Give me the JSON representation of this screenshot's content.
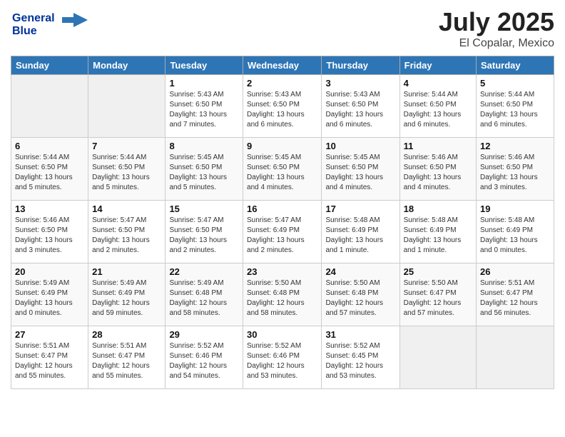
{
  "header": {
    "logo_line1": "General",
    "logo_line2": "Blue",
    "title": "July 2025",
    "subtitle": "El Copalar, Mexico"
  },
  "days_of_week": [
    "Sunday",
    "Monday",
    "Tuesday",
    "Wednesday",
    "Thursday",
    "Friday",
    "Saturday"
  ],
  "weeks": [
    [
      {
        "day": "",
        "empty": true
      },
      {
        "day": "",
        "empty": true
      },
      {
        "day": "1",
        "sunrise": "Sunrise: 5:43 AM",
        "sunset": "Sunset: 6:50 PM",
        "daylight": "Daylight: 13 hours and 7 minutes."
      },
      {
        "day": "2",
        "sunrise": "Sunrise: 5:43 AM",
        "sunset": "Sunset: 6:50 PM",
        "daylight": "Daylight: 13 hours and 6 minutes."
      },
      {
        "day": "3",
        "sunrise": "Sunrise: 5:43 AM",
        "sunset": "Sunset: 6:50 PM",
        "daylight": "Daylight: 13 hours and 6 minutes."
      },
      {
        "day": "4",
        "sunrise": "Sunrise: 5:44 AM",
        "sunset": "Sunset: 6:50 PM",
        "daylight": "Daylight: 13 hours and 6 minutes."
      },
      {
        "day": "5",
        "sunrise": "Sunrise: 5:44 AM",
        "sunset": "Sunset: 6:50 PM",
        "daylight": "Daylight: 13 hours and 6 minutes."
      }
    ],
    [
      {
        "day": "6",
        "sunrise": "Sunrise: 5:44 AM",
        "sunset": "Sunset: 6:50 PM",
        "daylight": "Daylight: 13 hours and 5 minutes."
      },
      {
        "day": "7",
        "sunrise": "Sunrise: 5:44 AM",
        "sunset": "Sunset: 6:50 PM",
        "daylight": "Daylight: 13 hours and 5 minutes."
      },
      {
        "day": "8",
        "sunrise": "Sunrise: 5:45 AM",
        "sunset": "Sunset: 6:50 PM",
        "daylight": "Daylight: 13 hours and 5 minutes."
      },
      {
        "day": "9",
        "sunrise": "Sunrise: 5:45 AM",
        "sunset": "Sunset: 6:50 PM",
        "daylight": "Daylight: 13 hours and 4 minutes."
      },
      {
        "day": "10",
        "sunrise": "Sunrise: 5:45 AM",
        "sunset": "Sunset: 6:50 PM",
        "daylight": "Daylight: 13 hours and 4 minutes."
      },
      {
        "day": "11",
        "sunrise": "Sunrise: 5:46 AM",
        "sunset": "Sunset: 6:50 PM",
        "daylight": "Daylight: 13 hours and 4 minutes."
      },
      {
        "day": "12",
        "sunrise": "Sunrise: 5:46 AM",
        "sunset": "Sunset: 6:50 PM",
        "daylight": "Daylight: 13 hours and 3 minutes."
      }
    ],
    [
      {
        "day": "13",
        "sunrise": "Sunrise: 5:46 AM",
        "sunset": "Sunset: 6:50 PM",
        "daylight": "Daylight: 13 hours and 3 minutes."
      },
      {
        "day": "14",
        "sunrise": "Sunrise: 5:47 AM",
        "sunset": "Sunset: 6:50 PM",
        "daylight": "Daylight: 13 hours and 2 minutes."
      },
      {
        "day": "15",
        "sunrise": "Sunrise: 5:47 AM",
        "sunset": "Sunset: 6:50 PM",
        "daylight": "Daylight: 13 hours and 2 minutes."
      },
      {
        "day": "16",
        "sunrise": "Sunrise: 5:47 AM",
        "sunset": "Sunset: 6:49 PM",
        "daylight": "Daylight: 13 hours and 2 minutes."
      },
      {
        "day": "17",
        "sunrise": "Sunrise: 5:48 AM",
        "sunset": "Sunset: 6:49 PM",
        "daylight": "Daylight: 13 hours and 1 minute."
      },
      {
        "day": "18",
        "sunrise": "Sunrise: 5:48 AM",
        "sunset": "Sunset: 6:49 PM",
        "daylight": "Daylight: 13 hours and 1 minute."
      },
      {
        "day": "19",
        "sunrise": "Sunrise: 5:48 AM",
        "sunset": "Sunset: 6:49 PM",
        "daylight": "Daylight: 13 hours and 0 minutes."
      }
    ],
    [
      {
        "day": "20",
        "sunrise": "Sunrise: 5:49 AM",
        "sunset": "Sunset: 6:49 PM",
        "daylight": "Daylight: 13 hours and 0 minutes."
      },
      {
        "day": "21",
        "sunrise": "Sunrise: 5:49 AM",
        "sunset": "Sunset: 6:49 PM",
        "daylight": "Daylight: 12 hours and 59 minutes."
      },
      {
        "day": "22",
        "sunrise": "Sunrise: 5:49 AM",
        "sunset": "Sunset: 6:48 PM",
        "daylight": "Daylight: 12 hours and 58 minutes."
      },
      {
        "day": "23",
        "sunrise": "Sunrise: 5:50 AM",
        "sunset": "Sunset: 6:48 PM",
        "daylight": "Daylight: 12 hours and 58 minutes."
      },
      {
        "day": "24",
        "sunrise": "Sunrise: 5:50 AM",
        "sunset": "Sunset: 6:48 PM",
        "daylight": "Daylight: 12 hours and 57 minutes."
      },
      {
        "day": "25",
        "sunrise": "Sunrise: 5:50 AM",
        "sunset": "Sunset: 6:47 PM",
        "daylight": "Daylight: 12 hours and 57 minutes."
      },
      {
        "day": "26",
        "sunrise": "Sunrise: 5:51 AM",
        "sunset": "Sunset: 6:47 PM",
        "daylight": "Daylight: 12 hours and 56 minutes."
      }
    ],
    [
      {
        "day": "27",
        "sunrise": "Sunrise: 5:51 AM",
        "sunset": "Sunset: 6:47 PM",
        "daylight": "Daylight: 12 hours and 55 minutes."
      },
      {
        "day": "28",
        "sunrise": "Sunrise: 5:51 AM",
        "sunset": "Sunset: 6:47 PM",
        "daylight": "Daylight: 12 hours and 55 minutes."
      },
      {
        "day": "29",
        "sunrise": "Sunrise: 5:52 AM",
        "sunset": "Sunset: 6:46 PM",
        "daylight": "Daylight: 12 hours and 54 minutes."
      },
      {
        "day": "30",
        "sunrise": "Sunrise: 5:52 AM",
        "sunset": "Sunset: 6:46 PM",
        "daylight": "Daylight: 12 hours and 53 minutes."
      },
      {
        "day": "31",
        "sunrise": "Sunrise: 5:52 AM",
        "sunset": "Sunset: 6:45 PM",
        "daylight": "Daylight: 12 hours and 53 minutes."
      },
      {
        "day": "",
        "empty": true
      },
      {
        "day": "",
        "empty": true
      }
    ]
  ]
}
